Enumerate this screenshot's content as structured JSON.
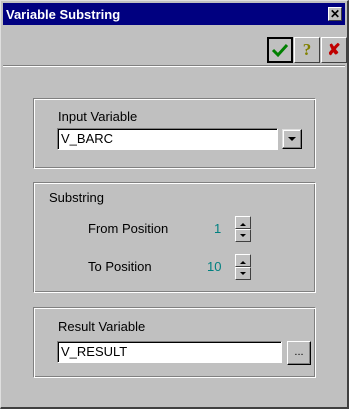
{
  "window": {
    "title": "Variable Substring"
  },
  "toolbar": {
    "ok_icon": "check-icon",
    "help_icon": "question-mark-icon",
    "cancel_icon": "x-icon"
  },
  "input_group": {
    "label": "Input Variable",
    "value": "V_BARC"
  },
  "substring_group": {
    "label": "Substring",
    "from_label": "From Position",
    "from_value": "1",
    "to_label": "To Position",
    "to_value": "10"
  },
  "result_group": {
    "label": "Result Variable",
    "value": "V_RESULT",
    "browse_label": "..."
  },
  "colors": {
    "titlebar": "#000080",
    "face": "#c0c0c0",
    "value_text": "#008080",
    "ok_check": "#008000",
    "help_mark": "#808000",
    "cancel_x": "#c00000"
  }
}
